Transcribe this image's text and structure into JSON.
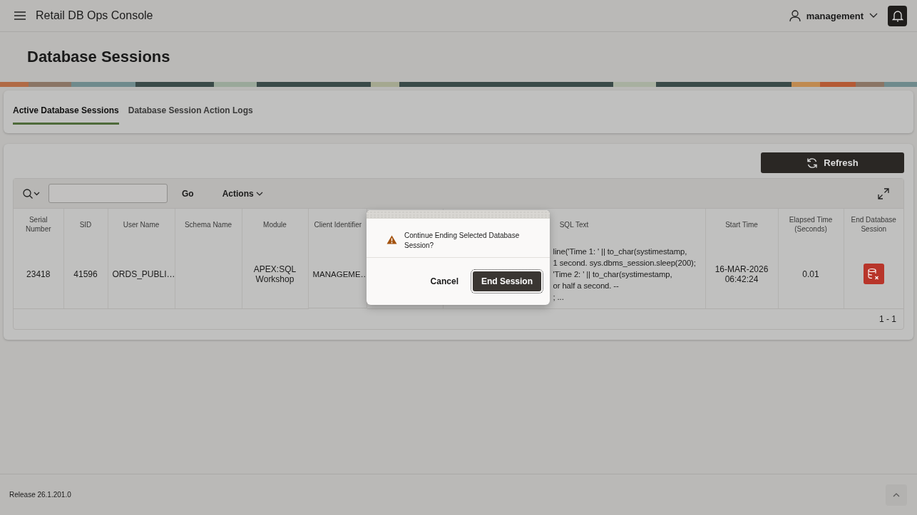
{
  "header": {
    "app_title": "Retail DB Ops Console",
    "user": "management"
  },
  "page_title": "Database Sessions",
  "tabs": [
    {
      "label": "Active Database Sessions",
      "selected": true
    },
    {
      "label": "Database Session Action Logs",
      "selected": false
    }
  ],
  "refresh_button": "Refresh",
  "toolbar": {
    "go": "Go",
    "actions": "Actions"
  },
  "table": {
    "columns": [
      {
        "label": "Serial Number",
        "kind": "text"
      },
      {
        "label": "SID",
        "kind": "text"
      },
      {
        "label": "User Name",
        "kind": "text"
      },
      {
        "label": "Schema Name",
        "kind": "text"
      },
      {
        "label": "Module",
        "kind": "text"
      },
      {
        "label": "Client Identifier",
        "kind": "clipped"
      },
      {
        "label": "SQL Text",
        "kind": "lines"
      },
      {
        "label": "Start Time",
        "kind": "text"
      },
      {
        "label": "Elapsed Time (Seconds)",
        "kind": "text"
      },
      {
        "label": "End Database Session",
        "kind": "action"
      }
    ],
    "rows": [
      {
        "cells": [
          "23418",
          "41596",
          "ORDS_PUBLI…",
          "",
          "APEX:SQL Workshop",
          "MANAGEME…",
          [
            "line('Time 1: ' || to_char(systimestamp,",
            "1 second. sys.dbms_session.sleep(200);",
            "'Time 2: ' || to_char(systimestamp,",
            "or half a second. --",
            "; ..."
          ],
          "16-MAR-2026 06:42:24",
          "0.01",
          ""
        ]
      }
    ],
    "pagination": "1 - 1"
  },
  "dialog": {
    "message": "Continue Ending Selected Database Session?",
    "buttons": [
      {
        "label": "Cancel",
        "kind": "secondary",
        "focused": false
      },
      {
        "label": "End Session",
        "kind": "primary",
        "focused": true
      }
    ]
  },
  "footer": {
    "release": "Release 26.1.201.0"
  }
}
